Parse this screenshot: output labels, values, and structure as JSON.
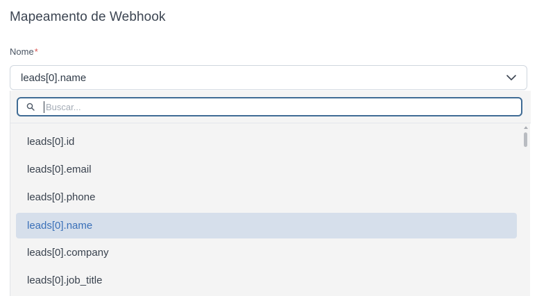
{
  "title": "Mapeamento de Webhook",
  "field": {
    "label": "Nome",
    "required_mark": "*",
    "selected_value": "leads[0].name"
  },
  "dropdown": {
    "search_placeholder": "Buscar...",
    "options": [
      {
        "label": "leads[0].id",
        "selected": false
      },
      {
        "label": "leads[0].email",
        "selected": false
      },
      {
        "label": "leads[0].phone",
        "selected": false
      },
      {
        "label": "leads[0].name",
        "selected": true
      },
      {
        "label": "leads[0].company",
        "selected": false
      },
      {
        "label": "leads[0].job_title",
        "selected": false
      }
    ]
  },
  "icons": {
    "select_toggle": "chevron-down-icon",
    "search": "search-icon"
  },
  "colors": {
    "accent": "#3a70b8",
    "selected_bg": "#d6dfeb",
    "search_border": "#3f6b94",
    "required": "#d9534f"
  }
}
